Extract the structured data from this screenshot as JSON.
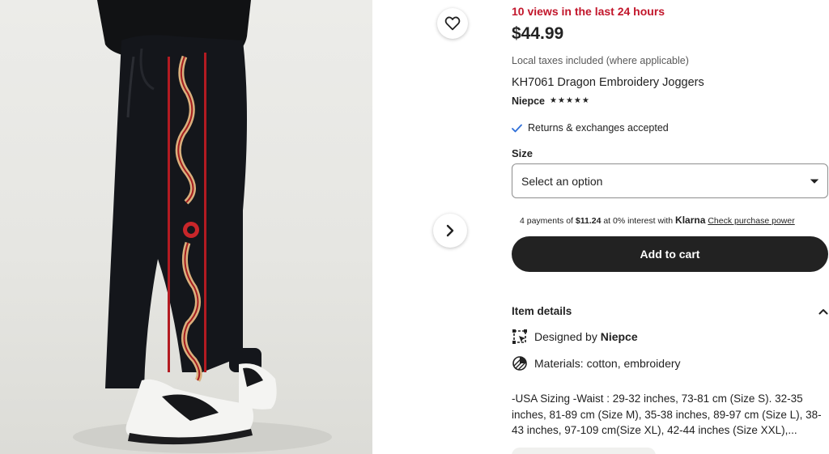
{
  "gallery": {
    "favorite_icon": "heart-outline-icon",
    "next_icon": "chevron-right-icon"
  },
  "listing": {
    "views_text": "10 views in the last 24 hours",
    "price": "$44.99",
    "tax_note": "Local taxes included (where applicable)",
    "title": "KH7061 Dragon Embroidery Joggers",
    "shop_name": "Niepce",
    "rating_stars": 5,
    "returns_text": "Returns & exchanges accepted"
  },
  "size": {
    "label": "Size",
    "selected": "Select an option"
  },
  "klarna": {
    "prefix": "4 payments of ",
    "amount": "$11.24",
    "middle": " at 0% interest with ",
    "brand": "Klarna",
    "link": "Check purchase power"
  },
  "cart": {
    "label": "Add to cart"
  },
  "item_details": {
    "heading": "Item details",
    "designed_prefix": "Designed by ",
    "designer": "Niepce",
    "materials": "Materials: cotton, embroidery",
    "description": "-USA Sizing -Waist : 29-32 inches, 73-81 cm (Size S). 32-35 inches, 81-89 cm (Size M), 35-38 inches, 89-97 cm (Size L), 38-43 inches, 97-109 cm(Size XL), 42-44 inches (Size XXL),..."
  },
  "colors": {
    "views_red": "#c2162b",
    "button_dark": "#222222",
    "check_blue": "#2f6fd8"
  }
}
